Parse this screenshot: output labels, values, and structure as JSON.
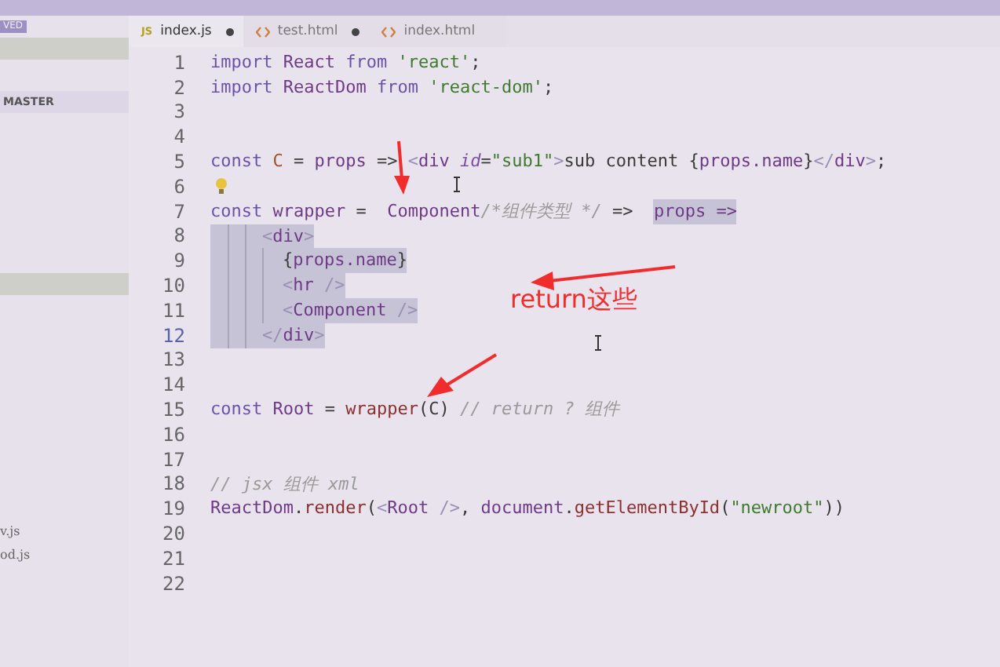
{
  "sidebar": {
    "badge": "VED",
    "section": "MASTER",
    "files": [
      "v.js",
      "od.js"
    ]
  },
  "tabs": [
    {
      "label": "index.js",
      "kind": "js",
      "icon_label": "JS",
      "selected": true,
      "modified": true
    },
    {
      "label": "test.html",
      "kind": "html",
      "selected": false,
      "modified": true
    },
    {
      "label": "index.html",
      "kind": "html",
      "selected": false,
      "modified": false
    }
  ],
  "editor": {
    "lines": [
      {
        "number": "1",
        "selected": false,
        "tokens": [
          {
            "kind": "kw",
            "text": "import "
          },
          {
            "kind": "var",
            "text": "React "
          },
          {
            "kind": "kw",
            "text": "from "
          },
          {
            "kind": "str",
            "text": "'react'"
          },
          {
            "kind": "plain",
            "text": ";"
          }
        ]
      },
      {
        "number": "2",
        "selected": false,
        "tokens": [
          {
            "kind": "kw",
            "text": "import "
          },
          {
            "kind": "var",
            "text": "ReactDom "
          },
          {
            "kind": "kw",
            "text": "from "
          },
          {
            "kind": "str",
            "text": "'react-dom'"
          },
          {
            "kind": "plain",
            "text": ";"
          }
        ]
      },
      {
        "number": "3",
        "selected": false
      },
      {
        "number": "4",
        "selected": false
      },
      {
        "number": "5",
        "selected": false,
        "tokens": [
          {
            "kind": "kw",
            "text": "const "
          },
          {
            "kind": "name",
            "text": "C"
          },
          {
            "kind": "plain",
            "text": " = "
          },
          {
            "kind": "var",
            "text": "props"
          },
          {
            "kind": "plain",
            "text": " => "
          },
          {
            "kind": "punc",
            "text": "<"
          },
          {
            "kind": "tag",
            "text": "div "
          },
          {
            "kind": "attr",
            "text": "id"
          },
          {
            "kind": "plain",
            "text": "="
          },
          {
            "kind": "str",
            "text": "\"sub1\""
          },
          {
            "kind": "punc",
            "text": ">"
          },
          {
            "kind": "plain",
            "text": "sub content {"
          },
          {
            "kind": "var",
            "text": "props.name"
          },
          {
            "kind": "plain",
            "text": "}"
          },
          {
            "kind": "punc",
            "text": "</"
          },
          {
            "kind": "tag",
            "text": "div"
          },
          {
            "kind": "punc",
            "text": ">"
          },
          {
            "kind": "plain",
            "text": ";"
          }
        ]
      },
      {
        "number": "6",
        "selected": false,
        "bulb": true
      },
      {
        "number": "7",
        "selected": false,
        "tokens": [
          {
            "kind": "kw",
            "text": "const ",
            "selected": false
          },
          {
            "kind": "var",
            "text": "wrapper",
            "selected": false
          },
          {
            "kind": "plain",
            "text": " =  ",
            "selected": false
          },
          {
            "kind": "var",
            "text": "Component",
            "selected": false
          },
          {
            "kind": "comment",
            "text": "/*组件类型 */",
            "selected": false
          },
          {
            "kind": "plain",
            "text": " =>  ",
            "selected": false
          },
          {
            "kind": "var",
            "text": "props =>",
            "selected": true
          }
        ],
        "children": [
          {
            "number": "8",
            "selected": true,
            "tokens": [
              {
                "kind": "punc",
                "text": "<"
              },
              {
                "kind": "tag",
                "text": "div"
              },
              {
                "kind": "punc",
                "text": ">"
              }
            ],
            "children": [
              {
                "number": "9",
                "selected": true,
                "tokens": [
                  {
                    "kind": "plain",
                    "text": "{"
                  },
                  {
                    "kind": "var",
                    "text": "props.name"
                  },
                  {
                    "kind": "plain",
                    "text": "}"
                  }
                ]
              },
              {
                "number": "10",
                "selected": true,
                "tokens": [
                  {
                    "kind": "punc",
                    "text": "<"
                  },
                  {
                    "kind": "tag",
                    "text": "hr "
                  },
                  {
                    "kind": "punc",
                    "text": "/>"
                  }
                ]
              },
              {
                "number": "11",
                "selected": true,
                "tokens": [
                  {
                    "kind": "punc",
                    "text": "<"
                  },
                  {
                    "kind": "tag",
                    "text": "Component "
                  },
                  {
                    "kind": "punc",
                    "text": "/>"
                  }
                ]
              }
            ]
          },
          {
            "number": "12",
            "selected": true,
            "tokens": [
              {
                "kind": "punc",
                "text": "</"
              },
              {
                "kind": "tag",
                "text": "div"
              },
              {
                "kind": "punc",
                "text": ">"
              }
            ]
          }
        ]
      },
      {
        "number": "13",
        "selected": false
      },
      {
        "number": "14",
        "selected": false
      },
      {
        "number": "15",
        "selected": false,
        "tokens": [
          {
            "kind": "kw",
            "text": "const "
          },
          {
            "kind": "var",
            "text": "Root"
          },
          {
            "kind": "plain",
            "text": " = "
          },
          {
            "kind": "fn",
            "text": "wrapper"
          },
          {
            "kind": "plain",
            "text": "(C) "
          },
          {
            "kind": "comment",
            "text": "// return ? 组件"
          }
        ]
      },
      {
        "number": "16",
        "selected": false
      },
      {
        "number": "17",
        "selected": false
      },
      {
        "number": "18",
        "selected": false,
        "tokens": [
          {
            "kind": "comment",
            "text": "// jsx 组件 xml"
          }
        ]
      },
      {
        "number": "19",
        "selected": false,
        "tokens": [
          {
            "kind": "var",
            "text": "ReactDom"
          },
          {
            "kind": "plain",
            "text": "."
          },
          {
            "kind": "fn",
            "text": "render"
          },
          {
            "kind": "plain",
            "text": "("
          },
          {
            "kind": "punc",
            "text": "<"
          },
          {
            "kind": "tag",
            "text": "Root "
          },
          {
            "kind": "punc",
            "text": "/>"
          },
          {
            "kind": "plain",
            "text": ", "
          },
          {
            "kind": "var",
            "text": "document"
          },
          {
            "kind": "plain",
            "text": "."
          },
          {
            "kind": "fn",
            "text": "getElementById"
          },
          {
            "kind": "plain",
            "text": "("
          },
          {
            "kind": "str",
            "text": "\"newroot\""
          },
          {
            "kind": "plain",
            "text": "))"
          }
        ]
      },
      {
        "number": "20",
        "selected": false
      },
      {
        "number": "21",
        "selected": false
      },
      {
        "number": "22",
        "selected": false
      }
    ]
  },
  "annotation": {
    "text": "return这些"
  }
}
